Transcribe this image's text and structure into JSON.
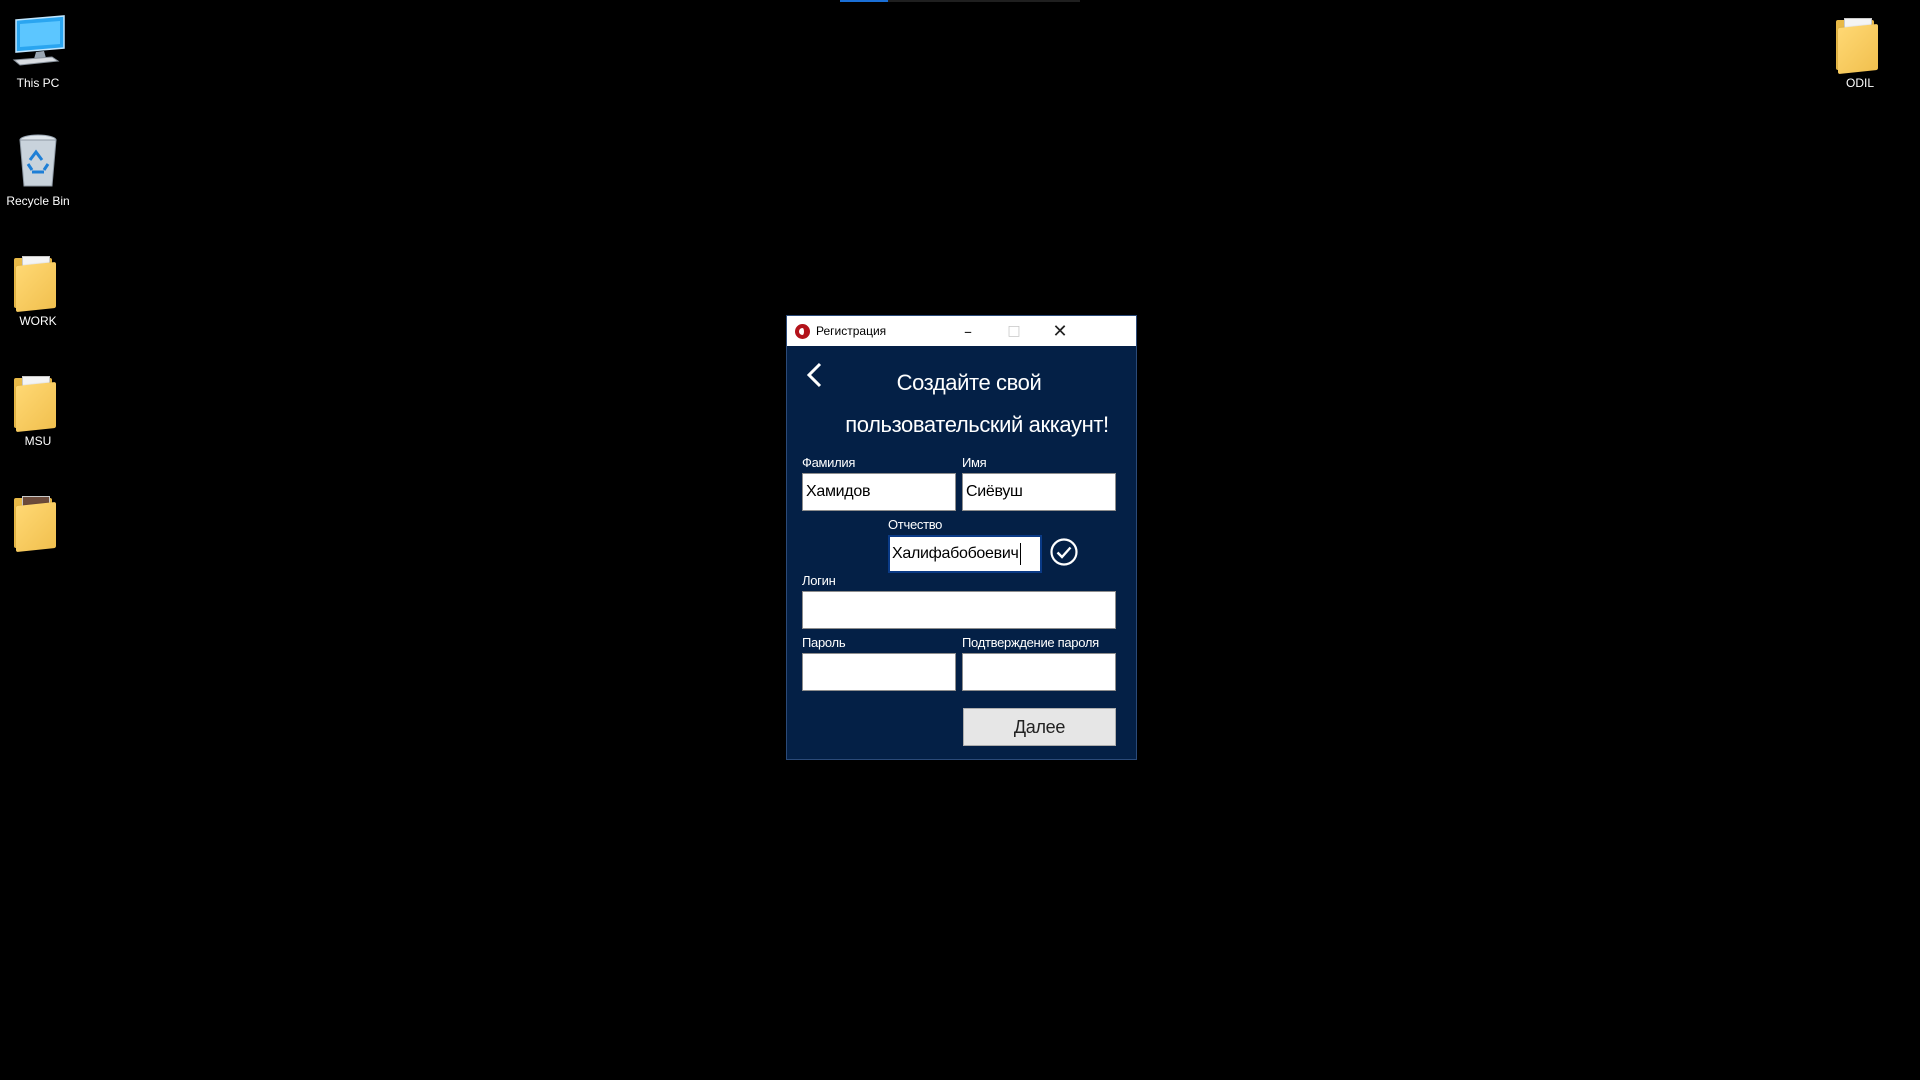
{
  "desktop": {
    "icons": [
      {
        "label": "This PC",
        "icon": "computer-icon"
      },
      {
        "label": "Recycle Bin",
        "icon": "recycle-bin-icon"
      },
      {
        "label": "WORK",
        "icon": "folder-icon"
      },
      {
        "label": "MSU",
        "icon": "folder-icon"
      },
      {
        "label": "",
        "icon": "folder-icon"
      },
      {
        "label": "ODIL",
        "icon": "folder-icon"
      }
    ]
  },
  "window": {
    "title": "Регистрация",
    "app_icon": "app-logo-icon",
    "heading_line1": "Создайте свой",
    "heading_line2": "пользовательский аккаунт!",
    "fields": {
      "surname": {
        "label": "Фамилия",
        "value": "Хамидов"
      },
      "name": {
        "label": "Имя",
        "value": "Сиёвуш"
      },
      "patronymic": {
        "label": "Отчество",
        "value": "Халифабобоевич"
      },
      "login": {
        "label": "Логин",
        "value": ""
      },
      "password": {
        "label": "Пароль",
        "value": ""
      },
      "password_confirm": {
        "label": "Подтверждение пароля",
        "value": ""
      }
    },
    "next_button": "Далее",
    "colors": {
      "background": "#042046",
      "titlebar": "#ffffff",
      "app_icon": "#b3131b"
    }
  }
}
